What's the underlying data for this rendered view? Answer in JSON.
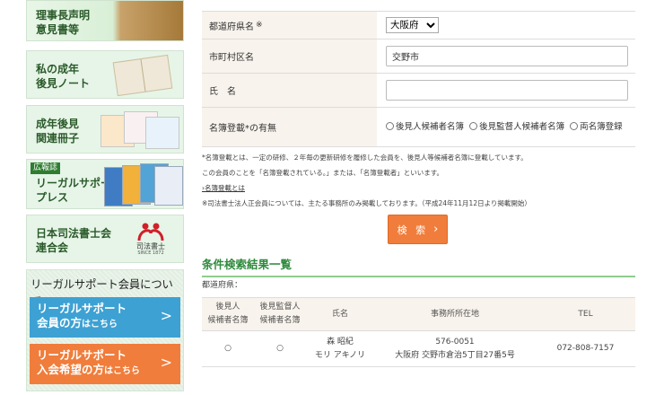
{
  "sidebar": {
    "banners": [
      {
        "line1": "理事長声明",
        "line2": "意見書等"
      },
      {
        "line1": "私の成年",
        "line2": "後見ノート"
      },
      {
        "line1": "成年後見",
        "line2": "関連冊子"
      },
      {
        "tag": "広報誌",
        "line1": "リーガルサポート",
        "line2": "プレス"
      },
      {
        "line1": "日本司法書士会",
        "line2": "連合会",
        "seal_caption": "司法書士",
        "seal_sub": "SINCE 1872"
      }
    ],
    "member_section": {
      "title": "リーガルサポート会員について",
      "member_button": {
        "line1": "リーガルサポート",
        "line2_main": "会員の方",
        "line2_small": "はこちら"
      },
      "join_button": {
        "line1": "リーガルサポート",
        "line2_main": "入会希望の方",
        "line2_small": "はこちら"
      }
    }
  },
  "form": {
    "prefecture": {
      "label": "都道府県名",
      "asterisk": "※",
      "selected": "大阪府"
    },
    "municipality": {
      "label": "市町村区名",
      "value": "交野市"
    },
    "name": {
      "label": "氏　名",
      "value": ""
    },
    "registry": {
      "label": "名簿登載*の有無",
      "options": [
        "後見人候補者名簿",
        "後見監督人候補者名簿",
        "両名簿登録"
      ]
    }
  },
  "notes": {
    "line1": "*名簿登載とは、一定の研修、２年毎の更新研修を履修した会員を、後見人等候補者名簿に登載しています。",
    "line2": "この会員のことを「名簿登載されている。」または、「名簿登載者」といいます。",
    "link": "›名簿登載とは",
    "line3": "※司法書士法人正会員については、主たる事務所のみ掲載しております。（平成24年11月12日より掲載開始）"
  },
  "search_button": {
    "label": "検 索",
    "chevron": "›"
  },
  "results": {
    "title": "条件検索結果一覧",
    "prefecture_line": "都道府県：",
    "headers": {
      "guardian": [
        "後見人",
        "候補者名簿"
      ],
      "supervisor": [
        "後見監督人",
        "候補者名簿"
      ],
      "name": "氏名",
      "office": "事務所所在地",
      "tel": "TEL"
    },
    "rows": [
      {
        "guardian": "○",
        "supervisor": "○",
        "name_kanji": "森 昭紀",
        "name_kana": "モリ アキノリ",
        "postal": "576-0051",
        "address": "大阪府 交野市倉治5丁目27番5号",
        "tel": "072-808-7157"
      }
    ]
  },
  "colors": {
    "accent_green": "#2f8a3c",
    "orange": "#f07d3b",
    "blue": "#3da1d3",
    "label_bg": "#f8f3ec"
  }
}
